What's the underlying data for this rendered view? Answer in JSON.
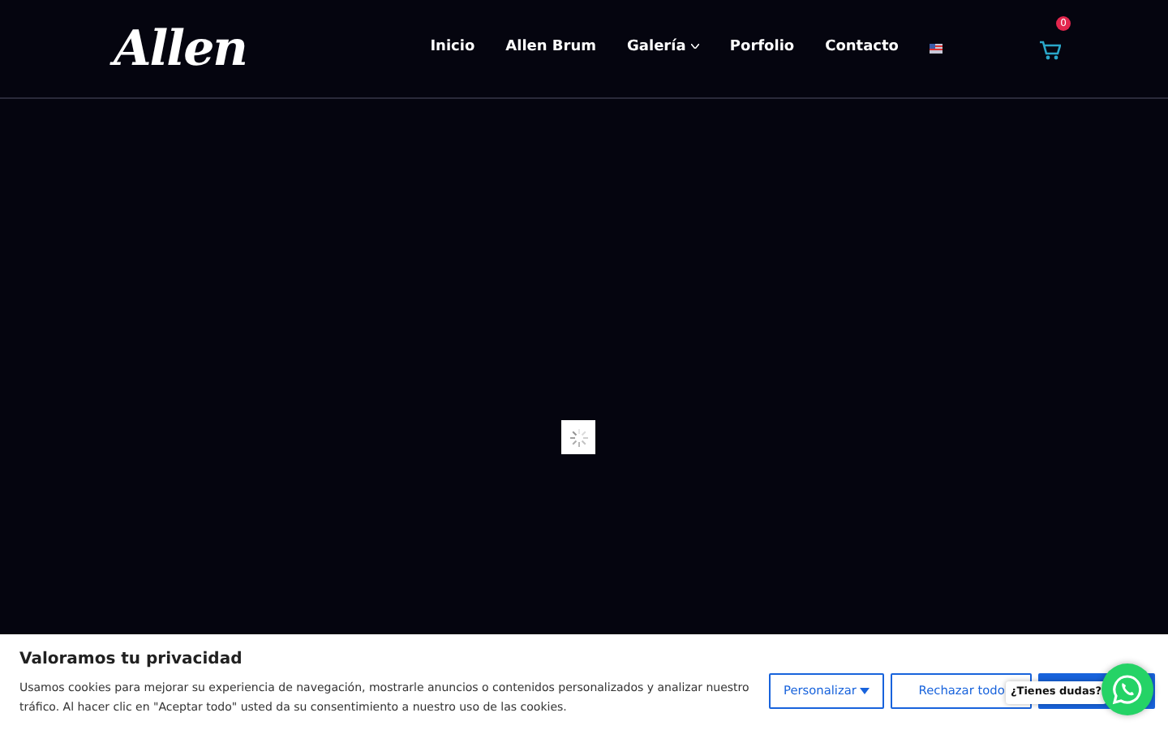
{
  "header": {
    "logo": "Allen",
    "nav": [
      {
        "label": "Inicio",
        "has_dropdown": false
      },
      {
        "label": "Allen Brum",
        "has_dropdown": false
      },
      {
        "label": "Galería",
        "has_dropdown": true
      },
      {
        "label": "Porfolio",
        "has_dropdown": false
      },
      {
        "label": "Contacto",
        "has_dropdown": false
      }
    ],
    "cart_count": "0"
  },
  "cookie_banner": {
    "title": "Valoramos tu privacidad",
    "text": "Usamos cookies para mejorar su experiencia de navegación, mostrarle anuncios o contenidos personalizados y analizar nuestro tráfico. Al hacer clic en \"Aceptar todo\" usted da su consentimiento a nuestro uso de las cookies.",
    "buttons": [
      {
        "label": "Personalizar",
        "kind": "dropdown"
      },
      {
        "label": "Rechazar todo",
        "kind": "outline"
      },
      {
        "kind": "primary"
      }
    ]
  },
  "chat": {
    "tooltip": "¿Tienes dudas?"
  }
}
